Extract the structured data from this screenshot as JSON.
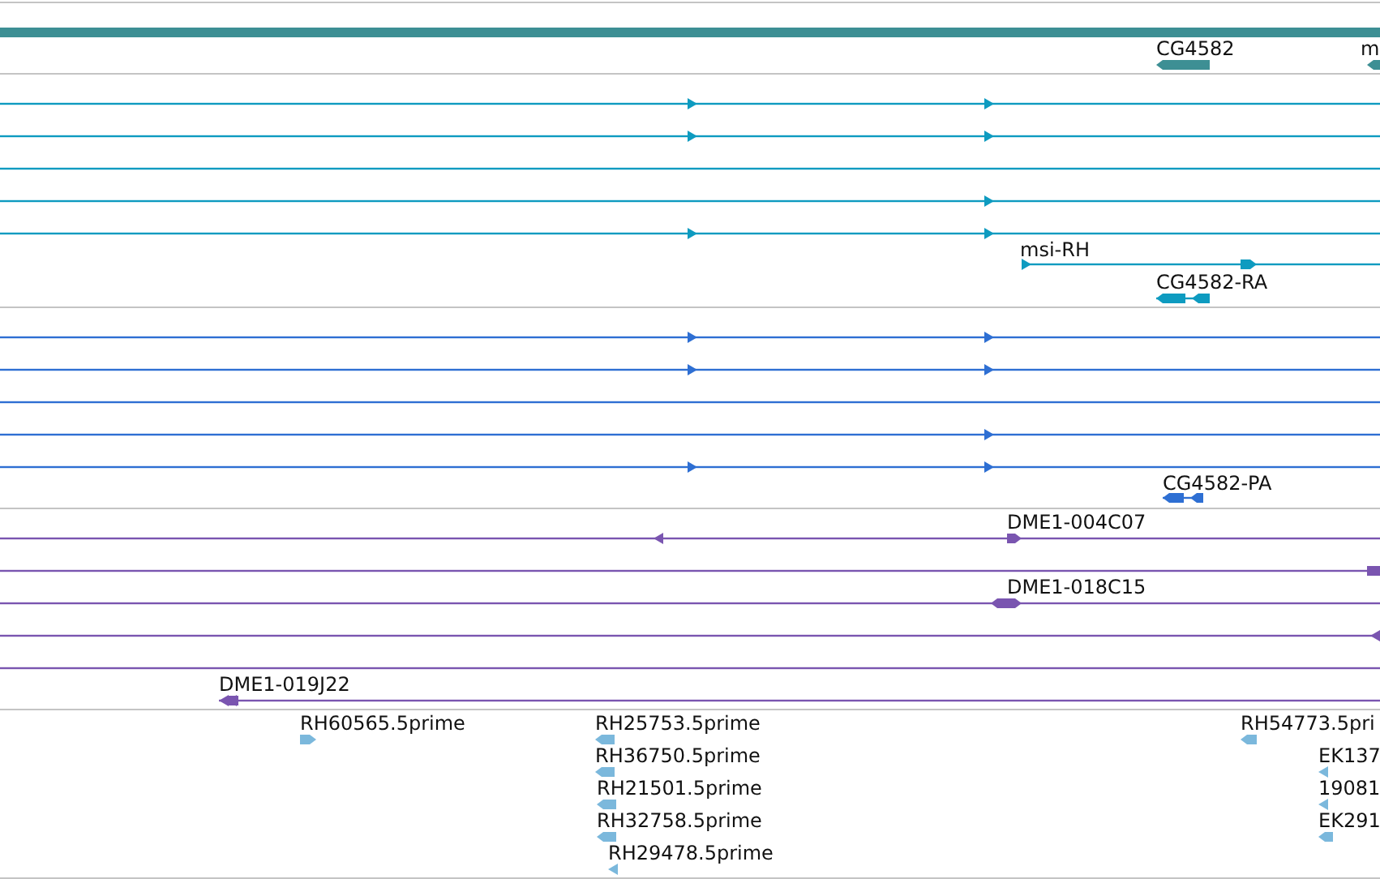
{
  "tracks": [
    {
      "kind": "gene",
      "color": "#3d8f94",
      "labels": [
        "CG4582",
        "m"
      ]
    },
    {
      "kind": "transcript",
      "color": "#0e9bc0",
      "labels": [
        "msi-RH",
        "CG4582-RA"
      ]
    },
    {
      "kind": "transcript",
      "color": "#2e6fd3",
      "labels": [
        "CG4582-PA"
      ]
    },
    {
      "kind": "clone",
      "color": "#7a55b0",
      "labels": [
        "DME1-004C07",
        "DME1-018C15",
        "DME1-019J22"
      ]
    },
    {
      "kind": "est",
      "color": "#7bb8dc",
      "labels": [
        "RH60565.5prime",
        "RH25753.5prime",
        "RH36750.5prime",
        "RH21501.5prime",
        "RH32758.5prime",
        "RH29478.5prime",
        "RH54773.5pri",
        "EK137",
        "19081",
        "EK291"
      ]
    }
  ]
}
